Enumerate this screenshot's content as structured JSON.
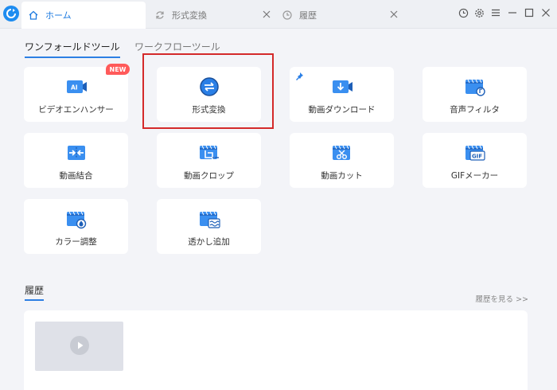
{
  "tabs": [
    {
      "label": "ホーム",
      "icon": "home-icon",
      "active": true
    },
    {
      "label": "形式変換",
      "icon": "refresh-icon",
      "active": false
    },
    {
      "label": "履歴",
      "icon": "clock-icon",
      "active": false
    }
  ],
  "window_controls": [
    "history-icon",
    "gear-icon",
    "menu-icon",
    "minimize-icon",
    "maximize-icon",
    "close-icon"
  ],
  "sections": {
    "one_tool": "ワンフォールドツール",
    "workflow": "ワークフローツール"
  },
  "tools": [
    {
      "label": "ビデオエンハンサー",
      "icon": "ai-enhance-icon",
      "badge": "NEW"
    },
    {
      "label": "形式変換",
      "icon": "convert-icon"
    },
    {
      "label": "動画ダウンロード",
      "icon": "download-icon"
    },
    {
      "label": "音声フィルタ",
      "icon": "audio-filter-icon"
    },
    {
      "label": "動画結合",
      "icon": "merge-icon"
    },
    {
      "label": "動画クロップ",
      "icon": "crop-icon"
    },
    {
      "label": "動画カット",
      "icon": "cut-icon"
    },
    {
      "label": "GIFメーカー",
      "icon": "gif-icon"
    },
    {
      "label": "カラー調整",
      "icon": "color-adjust-icon"
    },
    {
      "label": "透かし追加",
      "icon": "watermark-icon"
    }
  ],
  "history": {
    "title": "履歴",
    "view_link": "履歴を見る >>"
  },
  "colors": {
    "accent": "#2c7fe3",
    "badge": "#ff5a5a",
    "highlight": "#d42a2a"
  }
}
